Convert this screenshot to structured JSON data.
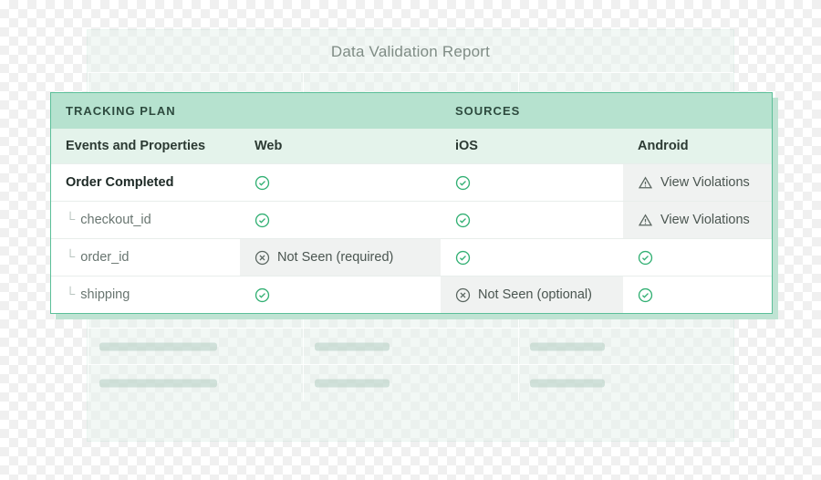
{
  "report_title": "Data Validation Report",
  "section_headers": {
    "tracking_plan": "TRACKING PLAN",
    "sources": "SOURCES"
  },
  "column_headers": {
    "events": "Events and Properties",
    "web": "Web",
    "ios": "iOS",
    "android": "Android"
  },
  "event": {
    "name": "Order Completed",
    "props": {
      "checkout_id": "checkout_id",
      "order_id": "order_id",
      "shipping": "shipping"
    }
  },
  "status": {
    "view_violations": "View Violations",
    "not_seen_required": "Not Seen (required)",
    "not_seen_optional": "Not Seen (optional)"
  }
}
